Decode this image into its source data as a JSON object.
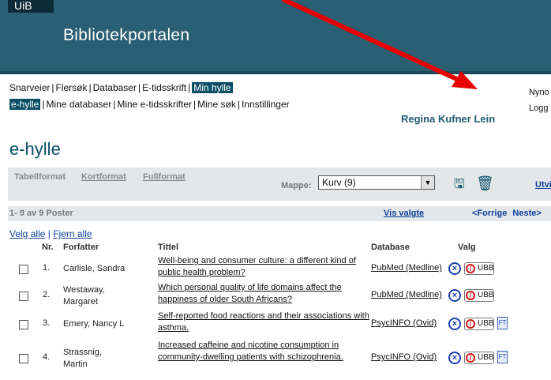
{
  "header": {
    "badge": "UiB",
    "title": "Bibliotekportalen"
  },
  "nav": {
    "primary": [
      "Snarveier",
      "Flersøk",
      "Databaser",
      "E-tidsskrift",
      "Min hylle"
    ],
    "primary_active_index": 4,
    "secondary": [
      "e-hylle",
      "Mine databaser",
      "Mine e-tidsskrifter",
      "Mine søk",
      "Innstillinger"
    ],
    "secondary_active_index": 0
  },
  "top_right": {
    "line1": "Nyno",
    "line2": "Logg"
  },
  "user_name": "Regina Kufner Lein",
  "page_title": "e-hylle",
  "toolbar": {
    "formats": [
      "Tabellformat",
      "Kortformat",
      "Fullformat"
    ],
    "mappe_label": "Mappe:",
    "folder_value": "Kurv (9)",
    "utvidet": "Utvidet",
    "icons": [
      "save-icon",
      "trash-icon"
    ]
  },
  "count_bar": {
    "count": "1- 9 av 9 Poster",
    "show_selected": "Vis valgte",
    "prev": "<Forrige",
    "next": "Neste>"
  },
  "select_links": {
    "select_all": "Velg alle",
    "separator": "|",
    "deselect_all": "Fjern alle"
  },
  "columns": [
    "Nr.",
    "Forfatter",
    "Tittel",
    "Database",
    "Valg"
  ],
  "rows": [
    {
      "nr": "1.",
      "author": "Carlisle, Sandra",
      "title": "Well-being and consumer culture: a different kind of public health problem?",
      "database": "PubMed (Medline)",
      "has_fulltext": false
    },
    {
      "nr": "2.",
      "author": "Westaway, Margaret",
      "title": "Which personal quality of life domains affect the happiness of older South Africans?",
      "database": "PubMed (Medline)",
      "has_fulltext": false
    },
    {
      "nr": "3.",
      "author": "Emery, Nancy L",
      "title": "Self-reported food reactions and their associations with asthma.",
      "database": "PsycINFO (Ovid)",
      "has_fulltext": true
    },
    {
      "nr": "4.",
      "author": "Strassnig, Martin",
      "title": "Increased caffeine and nicotine consumption in community-dwelling patients with schizophrenia.",
      "database": "PsycINFO (Ovid)",
      "has_fulltext": true
    }
  ],
  "valg": {
    "ubb_label": "UBB",
    "ft_label": "FT"
  },
  "colors": {
    "header_bg": "#2a5f73",
    "accent": "#0b4e66",
    "link": "#0b3e9a",
    "annotation_arrow": "#e60000"
  }
}
